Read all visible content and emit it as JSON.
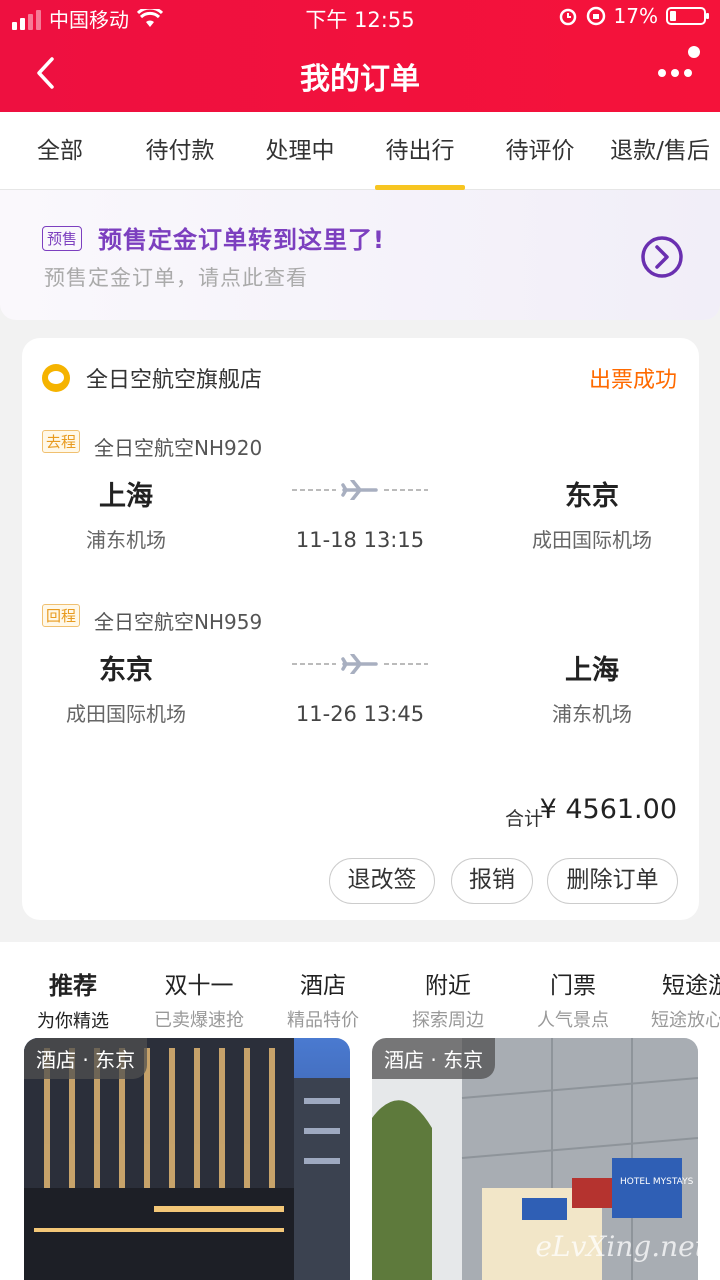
{
  "status_bar": {
    "carrier": "中国移动",
    "time": "下午 12:55",
    "battery": "17%"
  },
  "nav": {
    "title": "我的订单"
  },
  "tabs": [
    {
      "label": "全部"
    },
    {
      "label": "待付款"
    },
    {
      "label": "处理中"
    },
    {
      "label": "待出行",
      "active": true
    },
    {
      "label": "待评价"
    },
    {
      "label": "退款/售后"
    }
  ],
  "presale": {
    "tag": "预售",
    "title": "预售定金订单转到这里了!",
    "subtitle": "预售定金订单，请点此查看"
  },
  "order": {
    "shop": "全日空航空旗舰店",
    "status": "出票成功",
    "segments": [
      {
        "tag": "去程",
        "flight": "全日空航空NH920",
        "from_city": "上海",
        "from_airport": "浦东机场",
        "time": "11-18 13:15",
        "to_city": "东京",
        "to_airport": "成田国际机场"
      },
      {
        "tag": "回程",
        "flight": "全日空航空NH959",
        "from_city": "东京",
        "from_airport": "成田国际机场",
        "time": "11-26 13:45",
        "to_city": "上海",
        "to_airport": "浦东机场"
      }
    ],
    "total_label": "合计",
    "total_value": "¥ 4561.00",
    "buttons": {
      "change": "退改签",
      "reimburse": "报销",
      "delete": "删除订单"
    }
  },
  "recommend_tabs": [
    {
      "title": "推荐",
      "sub": "为你精选",
      "active": true
    },
    {
      "title": "双十一",
      "sub": "已卖爆速抢"
    },
    {
      "title": "酒店",
      "sub": "精品特价"
    },
    {
      "title": "附近",
      "sub": "探索周边"
    },
    {
      "title": "门票",
      "sub": "人气景点"
    },
    {
      "title": "短途游",
      "sub": "短途放心"
    }
  ],
  "hotels": [
    {
      "tag": "酒店 · 东京"
    },
    {
      "tag": "酒店 · 东京",
      "sign_text": "HOTEL MYSTAYS"
    }
  ],
  "watermark": "eLvXing.net",
  "colors": {
    "header": "#f0123c",
    "tab_underline": "#f7c521",
    "presale": "#7c3fbf",
    "status": "#ff6a00"
  }
}
